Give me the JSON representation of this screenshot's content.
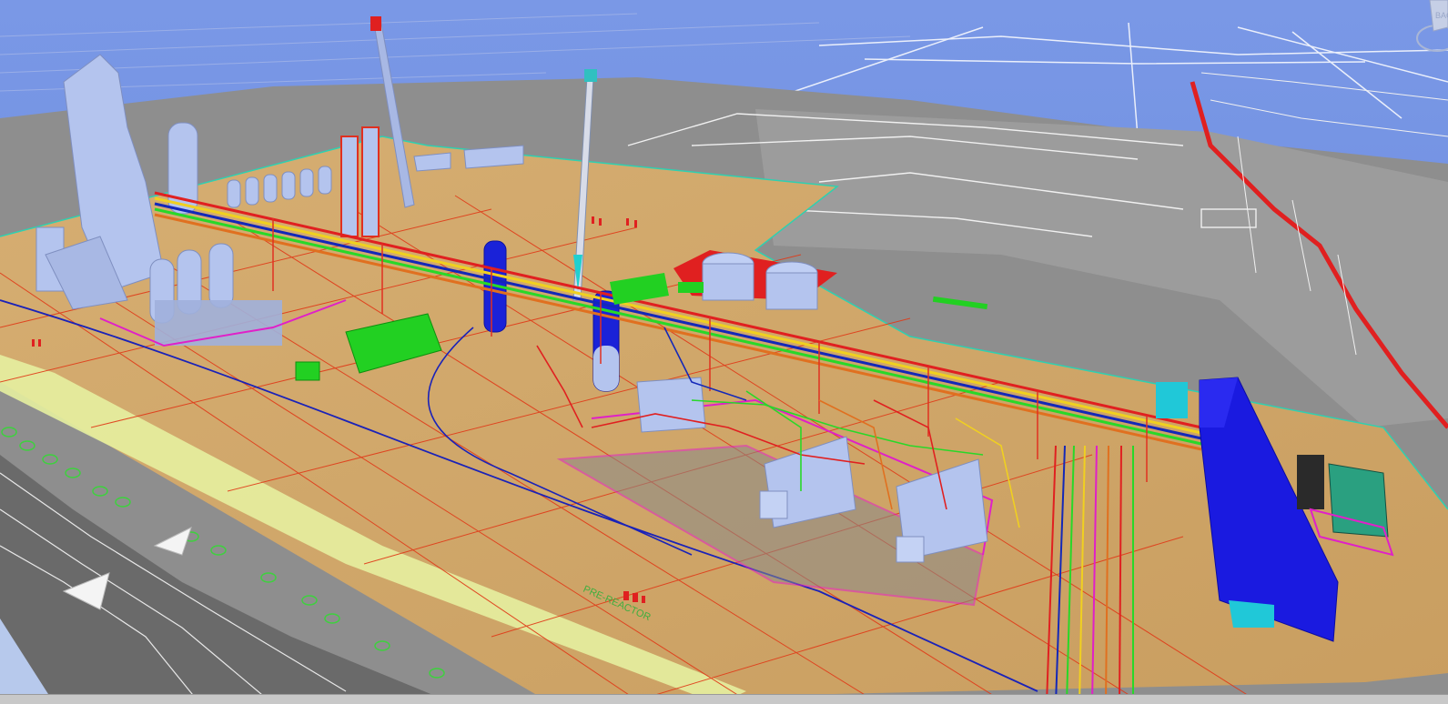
{
  "viewer": {
    "nav_cube_label": "BACK",
    "ground_label": "PRE-REACTOR"
  },
  "colors": {
    "sky": "#6f8fe0",
    "terrain": "#8c8c8c",
    "pad": "#d2a96a",
    "pipe_red": "#e02020",
    "pipe_blue": "#1428b8",
    "pipe_green": "#28d828",
    "pipe_yellow": "#f0d020",
    "equipment_light": "#b8c8f0",
    "vessel_blue": "#1a1ae0",
    "boundary_magenta": "#e020c8",
    "outline_green": "#50e050"
  },
  "icons": [
    "nav-cube-icon",
    "compass-ring-icon"
  ]
}
